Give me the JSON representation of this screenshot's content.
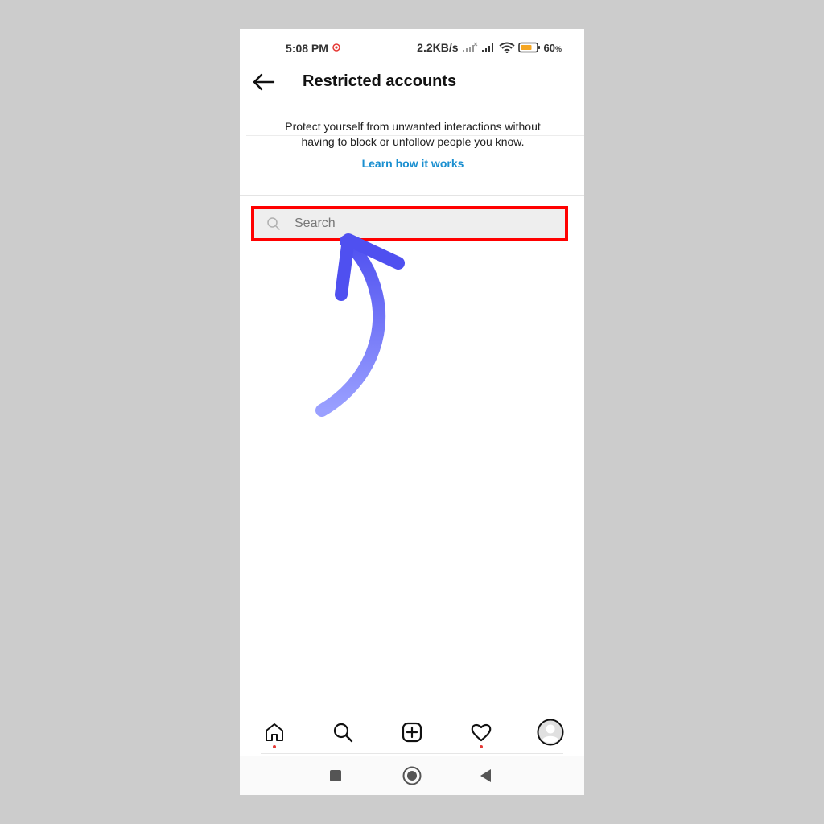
{
  "status_bar": {
    "time": "5:08 PM",
    "network_speed": "2.2KB/s",
    "battery_percent": "60",
    "battery_suffix": "%",
    "icons": [
      "notification-dot-icon",
      "signal-no-service-icon",
      "signal-icon",
      "wifi-icon",
      "battery-icon"
    ]
  },
  "header": {
    "title": "Restricted accounts",
    "back_icon": "arrow-left-icon"
  },
  "info": {
    "description": "Protect yourself from unwanted interactions without having to block or unfollow people you know.",
    "link_label": "Learn how it works",
    "link_color": "#1a8fd0"
  },
  "search": {
    "placeholder": "Search",
    "value": "",
    "highlight_color": "#ff0000"
  },
  "annotation": {
    "arrow_color": "#5a5cf5"
  },
  "bottom_nav": {
    "items": [
      "home-icon",
      "search-icon",
      "new-post-icon",
      "activity-heart-icon",
      "profile-avatar-icon"
    ]
  },
  "system_nav": {
    "items": [
      "recents-square-icon",
      "home-circle-icon",
      "back-triangle-icon"
    ]
  }
}
